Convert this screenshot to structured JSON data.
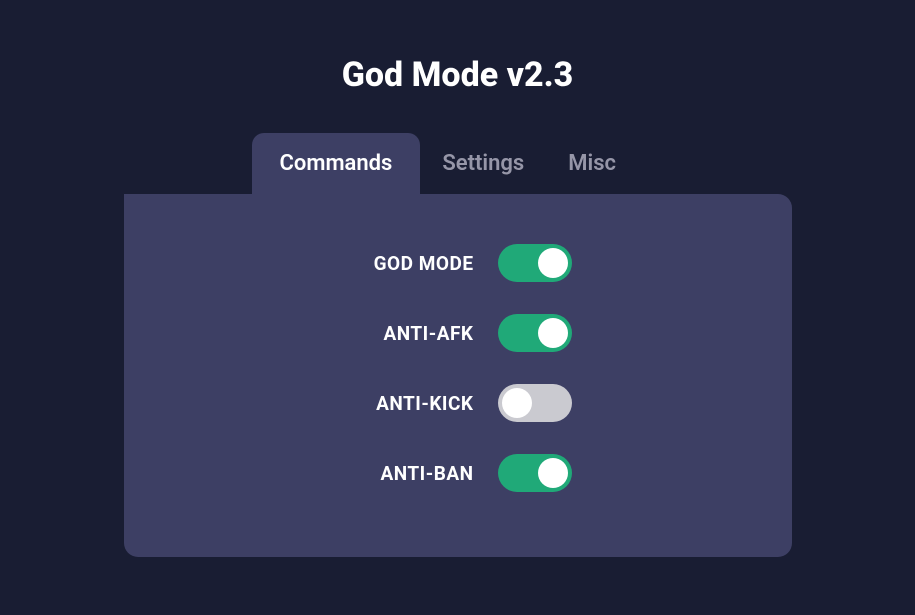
{
  "title": "God Mode v2.3",
  "tabs": [
    {
      "label": "Commands",
      "active": true
    },
    {
      "label": "Settings",
      "active": false
    },
    {
      "label": "Misc",
      "active": false
    }
  ],
  "options": [
    {
      "label": "GOD MODE",
      "enabled": true
    },
    {
      "label": "ANTI-AFK",
      "enabled": true
    },
    {
      "label": "ANTI-KICK",
      "enabled": false
    },
    {
      "label": "ANTI-BAN",
      "enabled": true
    }
  ],
  "colors": {
    "background": "#191d33",
    "panel": "#3d3f64",
    "toggleOn": "#20a978",
    "toggleOff": "#cacad0",
    "textPrimary": "#ffffff",
    "textSecondary": "#9696a8"
  }
}
